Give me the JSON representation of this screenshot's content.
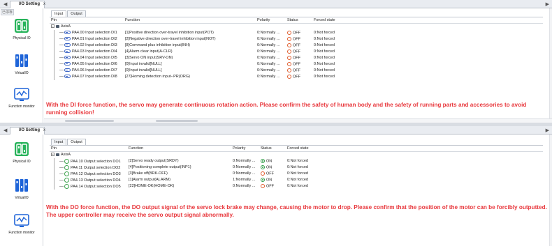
{
  "top": {
    "tab": {
      "title": "I/O Setting",
      "close": "x"
    },
    "float_label": "已停靠",
    "sidebar": [
      {
        "label": "Physical IO",
        "icon": "physical-io-icon"
      },
      {
        "label": "VirtualIO",
        "icon": "virtual-io-icon"
      },
      {
        "label": "Function monitor",
        "icon": "function-monitor-icon"
      }
    ],
    "subtabs": [
      "Input",
      "Output"
    ],
    "columns": {
      "pin": "Pin",
      "function": "Function",
      "polarity": "Polarity",
      "status": "Status",
      "forced": "Forced state"
    },
    "tree_root": "AxisA",
    "rows": [
      {
        "pin": "PA4.00 Input selection DI1",
        "function": "[1]Positive direction over-travel inhibition input(POT)",
        "polarity": "0:Normally ...",
        "status": "OFF",
        "status_on": false,
        "forced": "0:Not forced"
      },
      {
        "pin": "PA4.01 Input selection DI2",
        "function": "[2]Negative direction over-travel inhibition input(NOT)",
        "polarity": "0:Normally ...",
        "status": "OFF",
        "status_on": false,
        "forced": "0:Not forced"
      },
      {
        "pin": "PA4.02 Input selection DI3",
        "function": "[8]Command plus inhibition input(INH)",
        "polarity": "0:Normally ...",
        "status": "OFF",
        "status_on": false,
        "forced": "0:Not forced"
      },
      {
        "pin": "PA4.03 Input selection DI4",
        "function": "[4]Alarm clear input(A-CLR)",
        "polarity": "0:Normally ...",
        "status": "OFF",
        "status_on": false,
        "forced": "0:Not forced"
      },
      {
        "pin": "PA4.04 Input selection DI5",
        "function": "[3]Servo ON input(SRV-ON)",
        "polarity": "0:Normally ...",
        "status": "OFF",
        "status_on": false,
        "forced": "0:Not forced"
      },
      {
        "pin": "PA4.05 Input selection DI6",
        "function": "[0]Input invalid[NULL]",
        "polarity": "0:Normally ...",
        "status": "OFF",
        "status_on": false,
        "forced": "0:Not forced"
      },
      {
        "pin": "PA4.06 Input selection DI7",
        "function": "[0]Input invalid[NULL]",
        "polarity": "0:Normally ...",
        "status": "OFF",
        "status_on": false,
        "forced": "0:Not forced"
      },
      {
        "pin": "PA4.07 Input selection DI8",
        "function": "[27]Homing detection input--PR(ORG)",
        "polarity": "0:Normally ...",
        "status": "OFF",
        "status_on": false,
        "forced": "0:Not forced"
      }
    ],
    "warning": "With the DI force function, the servo may generate continuous rotation action. Please confirm the safety of human body and the safety of running parts and accessories to avoid running collision!"
  },
  "bottom": {
    "tab": {
      "title": "I/O Setting",
      "close": "x"
    },
    "sidebar": [
      {
        "label": "Physical IO",
        "icon": "physical-io-icon"
      },
      {
        "label": "VirtualIO",
        "icon": "virtual-io-icon"
      },
      {
        "label": "Function monitor",
        "icon": "function-monitor-icon"
      }
    ],
    "subtabs": [
      "Input",
      "Output"
    ],
    "columns": {
      "pin": "Pin",
      "function": "Function",
      "polarity": "Polarity",
      "status": "Status",
      "forced": "Forced state"
    },
    "tree_root": "AxisA",
    "rows": [
      {
        "pin": "PA4.10 Output selection DO1",
        "function": "[2]Servo ready output(SRDY)",
        "polarity": "0:Normally ...",
        "status": "ON",
        "status_on": true,
        "forced": "0:Not forced"
      },
      {
        "pin": "PA4.11 Output selection DO2",
        "function": "[4]Positioning complete output(INP1)",
        "polarity": "0:Normally ...",
        "status": "ON",
        "status_on": true,
        "forced": "0:Not forced"
      },
      {
        "pin": "PA4.12 Output selection DO3",
        "function": "[3]Brake off(BRK-OFF)",
        "polarity": "0:Normally ...",
        "status": "OFF",
        "status_on": false,
        "forced": "0:Not forced"
      },
      {
        "pin": "PA4.13 Output selection DO4",
        "function": "[1]Alarm output(ALARM)",
        "polarity": "1:Normally ...",
        "status": "ON",
        "status_on": true,
        "forced": "0:Not forced"
      },
      {
        "pin": "PA4.14 Output selection DO5",
        "function": "[22]HOME-OK(HOME-OK)",
        "polarity": "0:Normally ...",
        "status": "OFF",
        "status_on": false,
        "forced": "0:Not forced"
      }
    ],
    "warning": "With the DO force function, the DO output signal of the servo lock brake may change, causing the motor to drop. Please confirm that the position of the motor can be forcibly outputted. The upper controller may receive the servo output signal abnormally."
  },
  "colors": {
    "warning": "#e8383d",
    "off": "#e05a2a",
    "on": "#2e9b45",
    "accent": "#2f6fd6"
  }
}
